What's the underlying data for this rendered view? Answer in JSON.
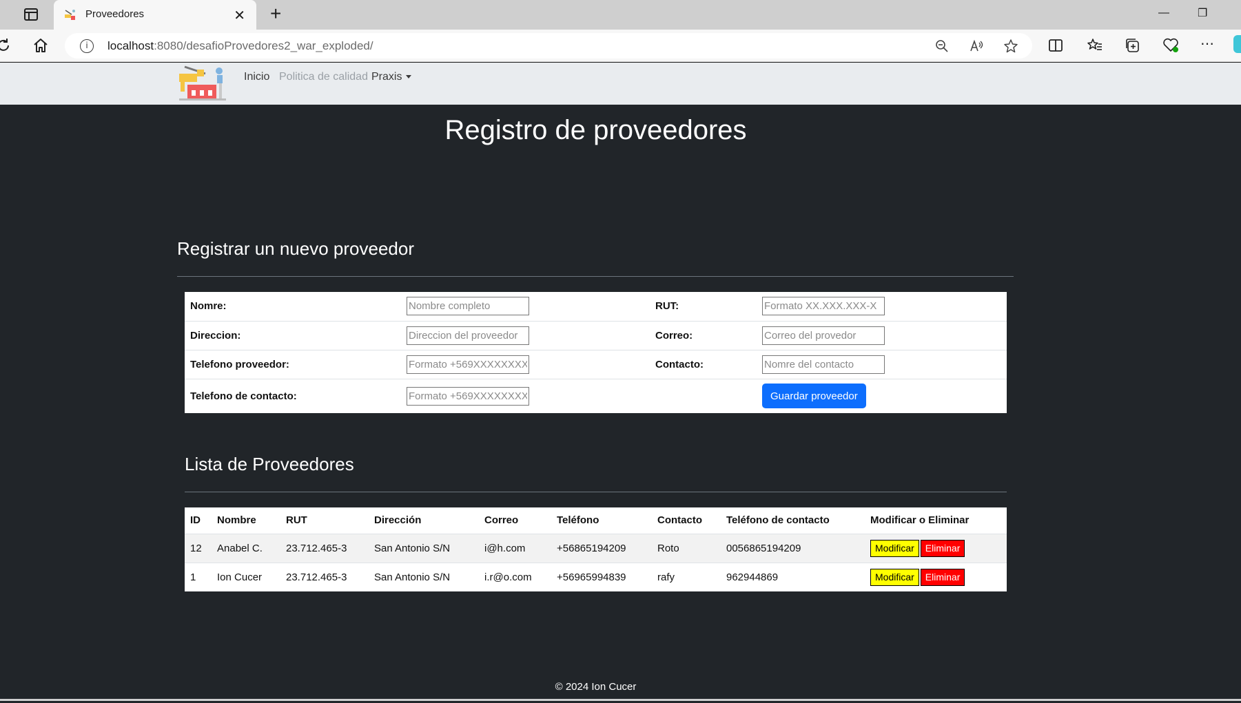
{
  "browser": {
    "tab_title": "Proveedores",
    "url_host": "localhost",
    "url_rest": ":8080/desafioProvedores2_war_exploded/"
  },
  "navbar": {
    "links": [
      "Inicio",
      "Politica de calidad",
      "Praxis"
    ]
  },
  "page": {
    "title": "Registro de proveedores",
    "footer": "© 2024 Ion Cucer"
  },
  "form": {
    "title": "Registrar un nuevo proveedor",
    "nombre_label": "Nomre:",
    "nombre_placeholder": "Nombre completo",
    "rut_label": "RUT:",
    "rut_placeholder": "Formato XX.XXX.XXX-X",
    "direccion_label": "Direccion:",
    "direccion_placeholder": "Direccion del proveedor",
    "correo_label": "Correo:",
    "correo_placeholder": "Correo del provedor",
    "telefono_label": "Telefono proveedor:",
    "telefono_placeholder": "Formato +569XXXXXXXX",
    "contacto_label": "Contacto:",
    "contacto_placeholder": "Nomre del contacto",
    "telefono_contacto_label": "Telefono de contacto:",
    "telefono_contacto_placeholder": "Formato +569XXXXXXXX",
    "submit_label": "Guardar proveedor"
  },
  "list": {
    "title": "Lista de Proveedores",
    "headers": [
      "ID",
      "Nombre",
      "RUT",
      "Dirección",
      "Correo",
      "Teléfono",
      "Contacto",
      "Teléfono de contacto",
      "Modificar o Eliminar"
    ],
    "rows": [
      {
        "id": "12",
        "nombre": "Anabel C.",
        "rut": "23.712.465-3",
        "direccion": "San Antonio S/N",
        "correo": "i@h.com",
        "telefono": "+56865194209",
        "contacto": "Roto",
        "telefono_contacto": "0056865194209"
      },
      {
        "id": "1",
        "nombre": "Ion Cucer",
        "rut": "23.712.465-3",
        "direccion": "San Antonio S/N",
        "correo": "i.r@o.com",
        "telefono": "+56965994839",
        "contacto": "rafy",
        "telefono_contacto": "962944869"
      }
    ],
    "modify_label": "Modificar",
    "delete_label": "Eliminar"
  },
  "colors": {
    "page_bg": "#212529",
    "navbar_bg": "#e9ecef",
    "primary": "#0d6efd",
    "modify_bg": "#ffff00",
    "delete_bg": "#ff0000"
  }
}
